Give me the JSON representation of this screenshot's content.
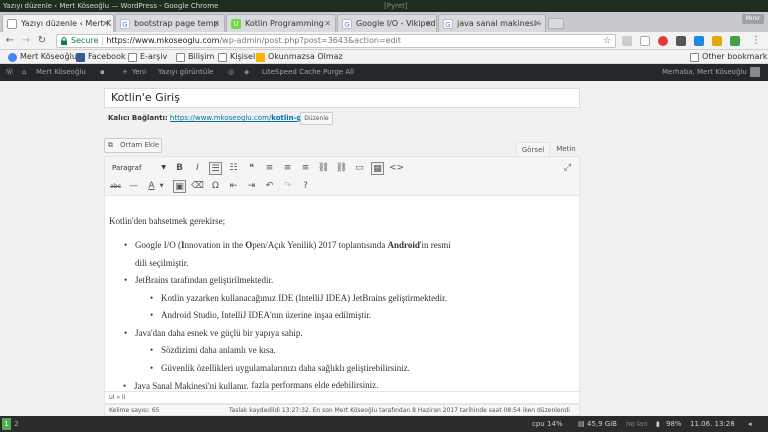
{
  "window": {
    "title": "Yazıyı düzenle ‹ Mert Köseoğlu — WordPress - Google Chrome",
    "project": "[Pyret]"
  },
  "tabs": [
    {
      "label": "Yazıyı düzenle ‹ Mert K",
      "icon": "page-icon",
      "active": true
    },
    {
      "label": "bootstrap page temp",
      "icon": "google-icon",
      "active": false
    },
    {
      "label": "Kotlin Programming",
      "icon": "upwork-icon",
      "active": false
    },
    {
      "label": "Google I/O - Vikipedi",
      "icon": "google-icon",
      "active": false
    },
    {
      "label": "java sanal makinesi - ",
      "icon": "google-icon",
      "active": false
    }
  ],
  "window_button_label": "Mınır",
  "address": {
    "secure_label": "Secure",
    "host": "https://www.mkoseoglu.com",
    "path": "/wp-admin/post.php?post=3643&action=edit"
  },
  "bookmarks": [
    {
      "label": "Mert Köseoğlu",
      "color": "#4285f4"
    },
    {
      "label": "Facebook",
      "color": "#3b5998"
    },
    {
      "label": "E-arşiv",
      "color": "#777777"
    },
    {
      "label": "Bilişim",
      "color": "#777777"
    },
    {
      "label": "Kişisel",
      "color": "#777777"
    },
    {
      "label": "Okunmazsa Olmaz",
      "color": "#f4b400"
    }
  ],
  "other_bookmarks": "Other bookmarks",
  "wpbar": {
    "site": "Mert Köseoğlu",
    "new": "Yeni",
    "view": "Yazıyı görüntüle",
    "cache": "LiteSpeed Cache Purge All",
    "greeting": "Merhaba, Mert Köseoğlu"
  },
  "post": {
    "title": "Kotlin'e Giriş",
    "permalink_label": "Kalıcı Bağlantı:",
    "permalink_base": "https://www.mkoseoglu.com/",
    "permalink_slug": "kotlin-giris",
    "permalink_end": "/",
    "edit_button": "Düzenle",
    "media_button": "Ortam Ekle",
    "tab_visual": "Görsel",
    "tab_text": "Metin",
    "format_select": "Paragraf",
    "intro": "Kotlin'den bahsetmek gerekirse;",
    "l1a_pre": "Google I/O (",
    "l1a_i": "I",
    "l1a_mid1": "nnovation in the ",
    "l1a_o": "O",
    "l1a_mid2": "pen/Açık Yenilik) 2017 toplantısında ",
    "l1a_android": "Android",
    "l1a_end": "'in resmi",
    "l1b": "dili seçilmiştir.",
    "l2": "JetBrains tarafından geliştirilmektedir.",
    "l2a": "Kotlin yazarken kullanacağımız IDE (IntelliJ IDEA) JetBrains geliştirmektedir.",
    "l2b": "Android Studio, IntelliJ IDEA'nın üzerine inşaa edilmiştir.",
    "l3": "Java'dan daha esnek ve güçlü bir yapıya sahip.",
    "l3a": "Sözdizimi daha anlamlı ve kısa.",
    "l3b": "Güvenlik özellikleri uygulamalarınızı daha sağlıklı geliştirebilirsiniz.",
    "l3c": "Uygulamalarınızda daha fazla performans elde edebilirsiniz.",
    "l4": "Java Sanal Makinesi'ni kullanır.",
    "path": "ul » li",
    "word_count": "Kelime sayısı: 65",
    "saved": "Taslak kaydedildi 13:27:32. En son Mert Köseoğlu tarafından 8 Haziran 2017 tarihinde saat 08:54 iken düzenlendi"
  },
  "taskbar": {
    "ws1": "1",
    "ws2": "2",
    "cpu": "cpu  14%",
    "disk": "45,9 GiB",
    "lan": "no lan",
    "battery": "98%",
    "clock": "11.06. 13:28"
  }
}
